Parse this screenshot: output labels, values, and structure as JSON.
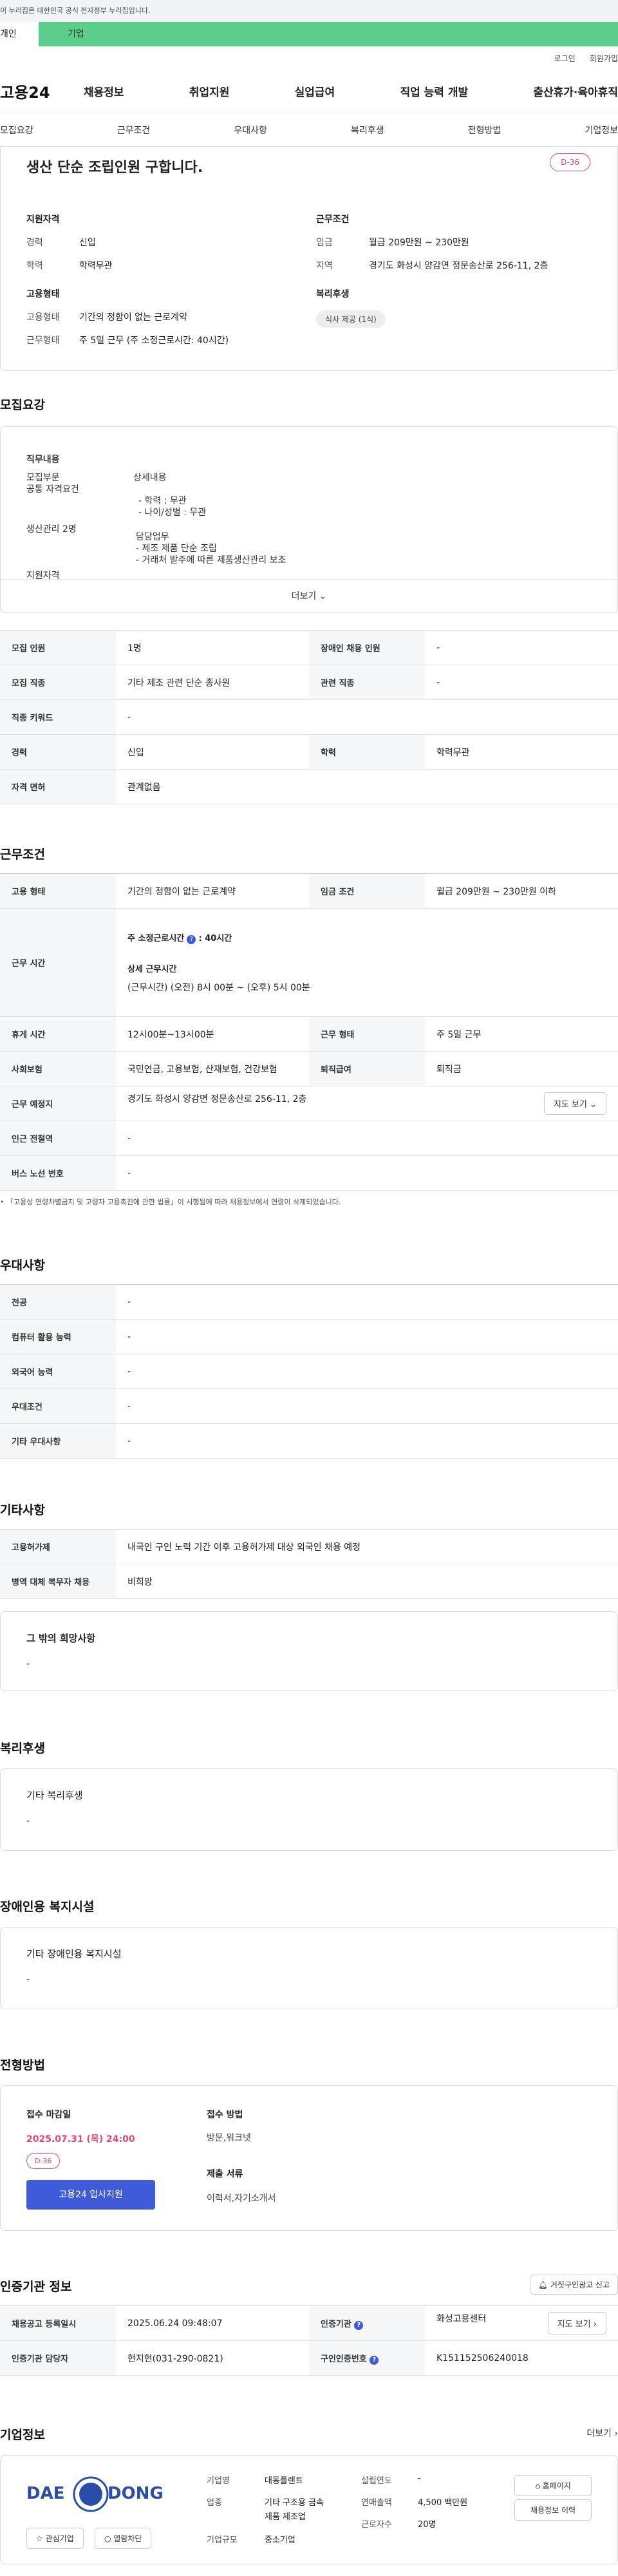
{
  "gov_banner": "이 누리집은 대한민국 공식 전자정부 누리집입니다.",
  "user_tabs": {
    "person": "개인",
    "business": "기업"
  },
  "util_links": [
    "로그인",
    "회원가입"
  ],
  "logo": "고용24",
  "gnb": [
    "채용정보",
    "취업지원",
    "실업급여",
    "직업 능력 개발",
    "출산휴가·육아휴직"
  ],
  "anchor_tabs": [
    "모집요강",
    "근무조건",
    "우대사항",
    "복리후생",
    "전형방법",
    "기업정보"
  ],
  "summary": {
    "title": "생산 단순 조립인원 구합니다.",
    "dday": "D-36",
    "qual": {
      "heading": "지원자격",
      "rows": [
        {
          "k": "경력",
          "v": "신입"
        },
        {
          "k": "학력",
          "v": "학력무관"
        }
      ]
    },
    "work": {
      "heading": "근무조건",
      "rows": [
        {
          "k": "임금",
          "v": "월급 209만원 ~ 230만원"
        },
        {
          "k": "지역",
          "v": "경기도 화성시 양감면 정문송산로 256-11, 2층"
        }
      ]
    },
    "employment": {
      "heading": "고용형태",
      "rows": [
        {
          "k": "고용형태",
          "v": "기간의 정함이 없는 근로계약"
        },
        {
          "k": "근무형태",
          "v": "주 5일 근무 (주 소정근로시간: 40시간)"
        }
      ]
    },
    "welfare": {
      "heading": "복리후생",
      "chip": "식사 제공 (1식)"
    }
  },
  "recruit": {
    "title": "모집요강",
    "jd_heading": "직무내용",
    "jd_left": [
      "모집부문",
      "공통 자격요건",
      "생산관리 2명",
      "지원자격"
    ],
    "jd_right": [
      "상세내용",
      "- 학력 : 무관",
      "- 나이/성별 : 무관",
      "담당업무",
      "- 제조 제품 단순 조립",
      "- 거래처 발주에 따른 제품생산관리 보조"
    ],
    "more": "더보기",
    "table": [
      {
        "k1": "모집 인원",
        "v1": "1명",
        "k2": "장애인 채용 인원",
        "v2": "-"
      },
      {
        "k1": "모집 직종",
        "v1": "기타 제조 관련 단순 종사원",
        "k2": "관련 직종",
        "v2": "-"
      },
      {
        "k1": "직종 키워드",
        "v1": "-"
      },
      {
        "k1": "경력",
        "v1": "신입",
        "k2": "학력",
        "v2": "학력무관"
      },
      {
        "k1": "자격 면허",
        "v1": "관계없음"
      }
    ]
  },
  "conditions": {
    "title": "근무조건",
    "employ_type_k": "고용 형태",
    "employ_type_v": "기간의 정함이 없는 근로계약",
    "wage_k": "임금 조건",
    "wage_v": "월급 209만원 ~ 230만원 이하",
    "hours_k": "근무 시간",
    "hours_1": "주 소정근로시간",
    "hours_1b": ": 40시간",
    "hours_2": "상세 근무시간",
    "hours_3": "(근무시간) (오전) 8시 00분 ~ (오후) 5시 00분",
    "rest_k": "휴게 시간",
    "rest_v": "12시00분~13시00분",
    "shape_k": "근무 형태",
    "shape_v": "주 5일 근무",
    "insur_k": "사회보험",
    "insur_v": "국민연금, 고용보험, 산재보험, 건강보험",
    "retire_k": "퇴직급여",
    "retire_v": "퇴직금",
    "place_k": "근무 예정지",
    "place_v": "경기도 화성시 양감면 정문송산로 256-11, 2층",
    "map_btn": "지도 보기",
    "subway_k": "인근 전철역",
    "subway_v": "-",
    "bus_k": "버스 노선 번호",
    "bus_v": "-",
    "note": "「고용상 연령차별금지 및 고령자 고용촉진에 관한 법률」이 시행됨에 따라 채용정보에서 연령이 삭제되었습니다."
  },
  "prefer": {
    "title": "우대사항",
    "rows": [
      {
        "k": "전공",
        "v": "-"
      },
      {
        "k": "컴퓨터 활용 능력",
        "v": "-"
      },
      {
        "k": "외국어 능력",
        "v": "-"
      },
      {
        "k": "우대조건",
        "v": "-"
      },
      {
        "k": "기타 우대사항",
        "v": "-"
      }
    ]
  },
  "etc": {
    "title": "기타사항",
    "rows": [
      {
        "k": "고용허가제",
        "v": "내국인 구인 노력 기간 이후 고용허가제 대상 외국인 채용 예정"
      },
      {
        "k": "병역 대체 복무자 채용",
        "v": "비희망"
      }
    ],
    "hope_title": "그 밖의 희망사항",
    "hope_value": "-"
  },
  "benefit": {
    "title": "복리후생",
    "card_title": "기타 복리후생",
    "card_value": "-"
  },
  "disabled": {
    "title": "장애인용 복지시설",
    "card_title": "기타 장애인용 복지시설",
    "card_value": "-"
  },
  "process": {
    "title": "전형방법",
    "deadline_label": "접수 마감일",
    "deadline": "2025.07.31 (목) 24:00",
    "dday": "D-36",
    "apply_btn": "고용24 입사지원",
    "method_label": "접수 방법",
    "method": "방문,워크넷",
    "docs_label": "제출 서류",
    "docs": "이력서,자기소개서"
  },
  "cert": {
    "title": "인증기관 정보",
    "report_btn": "거짓구인광고 신고",
    "reg_k": "채용공고 등록일시",
    "reg_v": "2025.06.24 09:48:07",
    "org_k": "인증기관",
    "org_v": "화성고용센터",
    "map_btn": "지도 보기",
    "mgr_k": "인증기관 담당자",
    "mgr_v": "현지현(031-290-0821)",
    "no_k": "구인인증번호",
    "no_v": "K151152506240018"
  },
  "company": {
    "title": "기업정보",
    "more": "더보기",
    "logo_left": "DAE",
    "logo_right": "DONG",
    "fav_btn": "관심기업",
    "block_btn": "열람차단",
    "name_k": "기업명",
    "name_v": "대동플랜트",
    "biz_k": "업종",
    "biz_v1": "기타 구조용 금속",
    "biz_v2": "제품 제조업",
    "size_k": "기업규모",
    "size_v": "중소기업",
    "year_k": "설립연도",
    "year_v": "-",
    "sales_k": "연매출액",
    "sales_v": "4,500 백만원",
    "emp_k": "근로자수",
    "emp_v": "20명",
    "home_btn": "홈페이지",
    "jobs_btn": "채용정보 이력"
  },
  "colors": {
    "accent": "#3f5bd9",
    "pink": "#e0457b",
    "green": "#5dcd8c"
  }
}
